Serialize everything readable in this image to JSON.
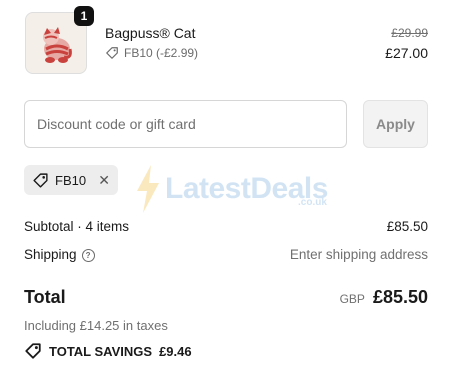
{
  "product": {
    "quantity": "1",
    "name": "Bagpuss® Cat",
    "discount_label": "FB10 (-£2.99)",
    "price_original": "£29.99",
    "price_discounted": "£27.00",
    "image_icon": "plush-cat-icon"
  },
  "discount": {
    "placeholder": "Discount code or gift card",
    "apply_label": "Apply"
  },
  "applied_code": {
    "code": "FB10",
    "icon": "tag-icon",
    "remove_icon": "close-icon"
  },
  "watermark": {
    "text": "LatestDeals",
    "sub": ".co.uk"
  },
  "summary": {
    "subtotal_label": "Subtotal · 4 items",
    "subtotal_value": "£85.50",
    "shipping_label": "Shipping",
    "shipping_value": "Enter shipping address",
    "total_label": "Total",
    "currency": "GBP",
    "total_value": "£85.50",
    "taxes": "Including £14.25 in taxes",
    "savings_label": "TOTAL SAVINGS",
    "savings_value": "£9.46"
  },
  "colors": {
    "accent_text": "#1a1a1a",
    "muted_text": "#707070",
    "watermark": "#7fb3e0"
  }
}
